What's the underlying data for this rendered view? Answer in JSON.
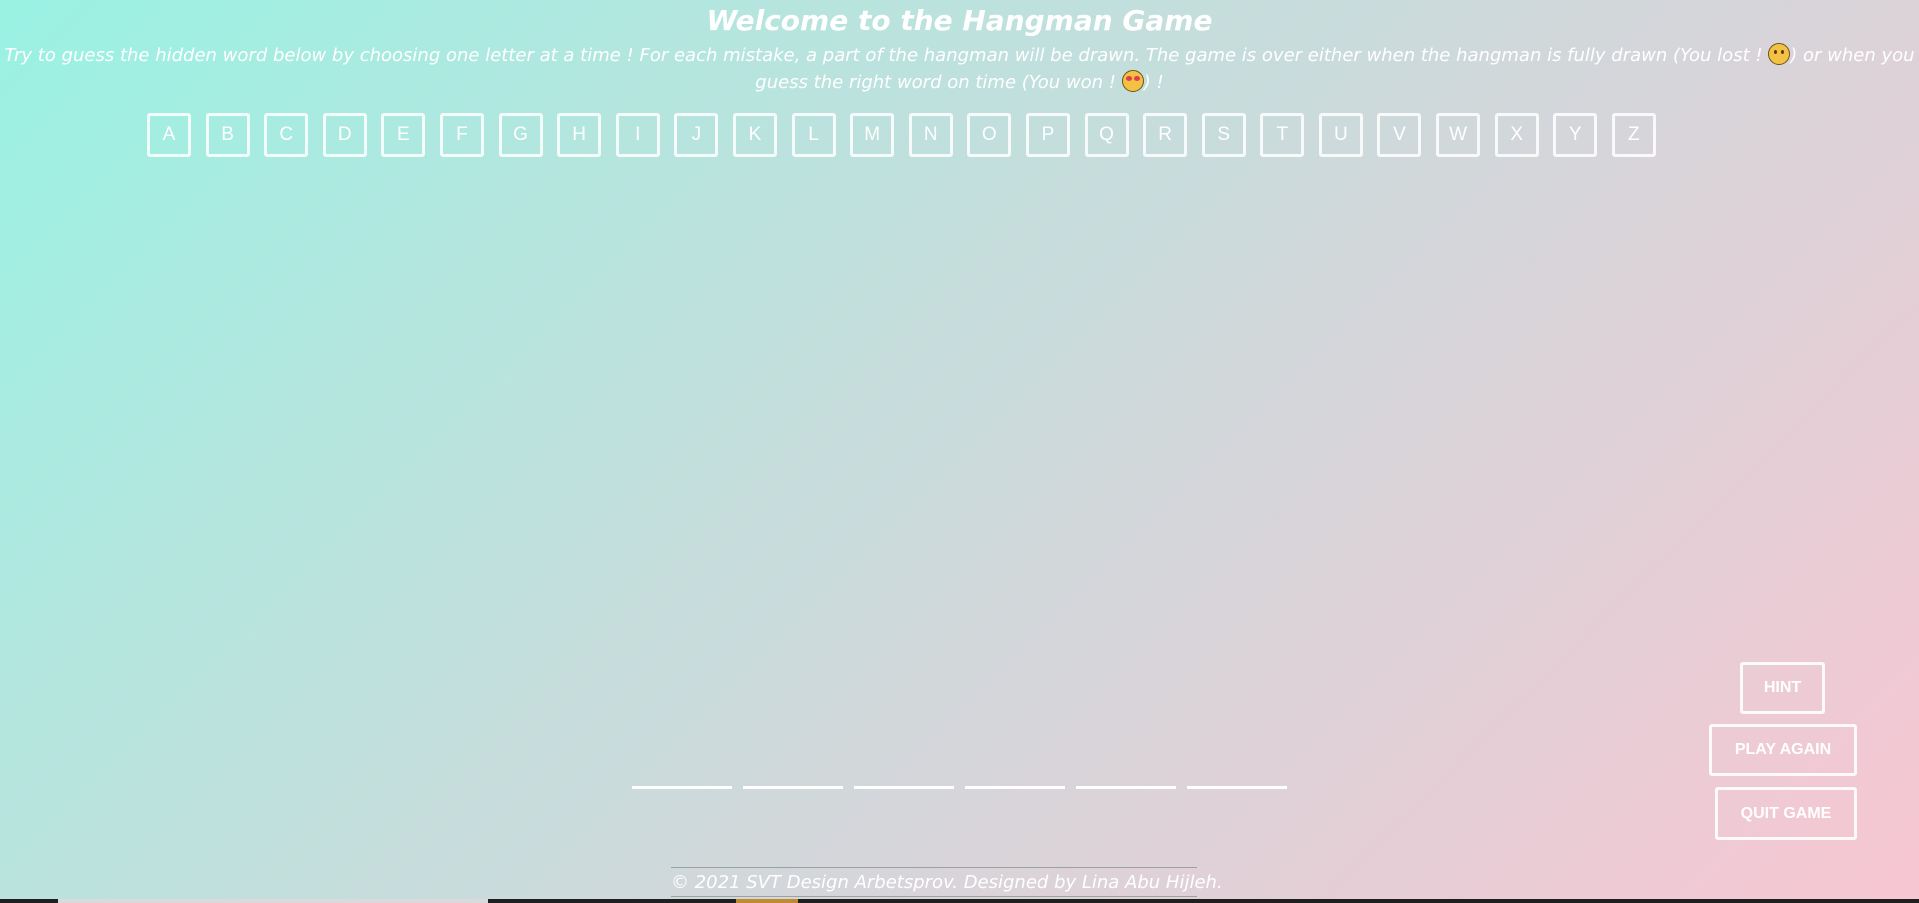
{
  "header": {
    "title": "Welcome to the Hangman Game",
    "intro_part1": "Try to guess the hidden word below by choosing one letter at a time ! For each mistake, a part of the hangman will be drawn. The game is over either when the hangman is fully drawn (You lost ! ",
    "intro_part2": ") or when you guess the right word on time (You won ! ",
    "intro_part3": ") !"
  },
  "letters": [
    "A",
    "B",
    "C",
    "D",
    "E",
    "F",
    "G",
    "H",
    "I",
    "J",
    "K",
    "L",
    "M",
    "N",
    "O",
    "P",
    "Q",
    "R",
    "S",
    "T",
    "U",
    "V",
    "W",
    "X",
    "Y",
    "Z"
  ],
  "word_slots": 6,
  "buttons": {
    "hint": "HINT",
    "play_again": "PLAY AGAIN",
    "quit_game": "QUIT GAME"
  },
  "footer": {
    "text": "© 2021 SVT Design Arbetsprov. Designed by Lina Abu Hijleh."
  },
  "icons": {
    "lost": "sad-face-emoji",
    "won": "heart-eyes-emoji"
  },
  "colors": {
    "gradient_start": "#99f2e3",
    "gradient_end": "#f7c6d2",
    "foreground": "#ffffff"
  }
}
